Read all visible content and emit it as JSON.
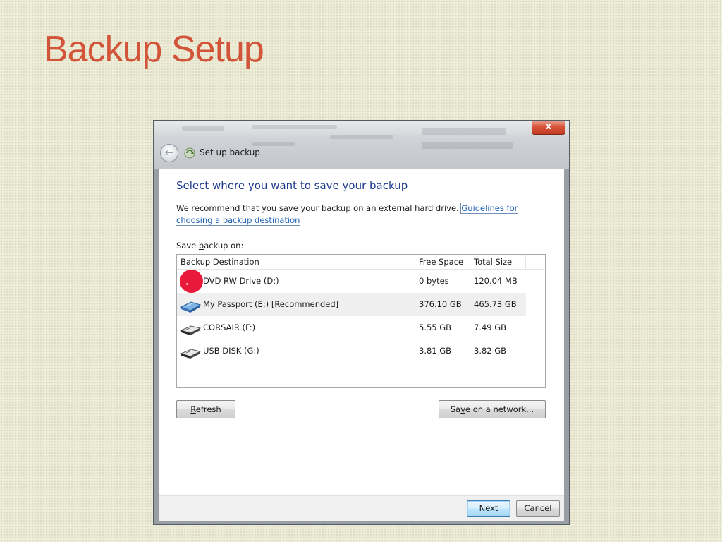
{
  "slide": {
    "title": "Backup Setup"
  },
  "window": {
    "title": "Set up backup",
    "close_label": "x",
    "back_glyph": "←"
  },
  "content": {
    "heading": "Select where you want to save your backup",
    "desc_text": "We recommend that you save your backup on an external hard drive. ",
    "desc_link": "Guidelines for choosing a backup destination",
    "save_label_pre": "Save ",
    "save_label_key": "b",
    "save_label_post": "ackup on:"
  },
  "table": {
    "headers": [
      "Backup Destination",
      "Free Space",
      "Total Size"
    ],
    "rows": [
      {
        "name": "DVD RW Drive (D:)",
        "free": "0 bytes",
        "total": "120.04 MB",
        "icon": "dvd-drive-icon"
      },
      {
        "name": "My Passport (E:) [Recommended]",
        "free": "376.10 GB",
        "total": "465.73 GB",
        "icon": "external-drive-icon"
      },
      {
        "name": "CORSAIR (F:)",
        "free": "5.55 GB",
        "total": "7.49 GB",
        "icon": "usb-drive-icon"
      },
      {
        "name": "USB DISK (G:)",
        "free": "3.81 GB",
        "total": "3.82 GB",
        "icon": "usb-drive-icon"
      }
    ]
  },
  "buttons": {
    "refresh_key": "R",
    "refresh_rest": "efresh",
    "network_pre": "Sa",
    "network_key": "v",
    "network_post": "e on a network...",
    "next_key": "N",
    "next_rest": "ext",
    "cancel": "Cancel"
  },
  "colors": {
    "title": "#d2553a",
    "heading": "#1e3a8c",
    "link": "#1f5fb5",
    "click_marker": "#e8193a"
  }
}
